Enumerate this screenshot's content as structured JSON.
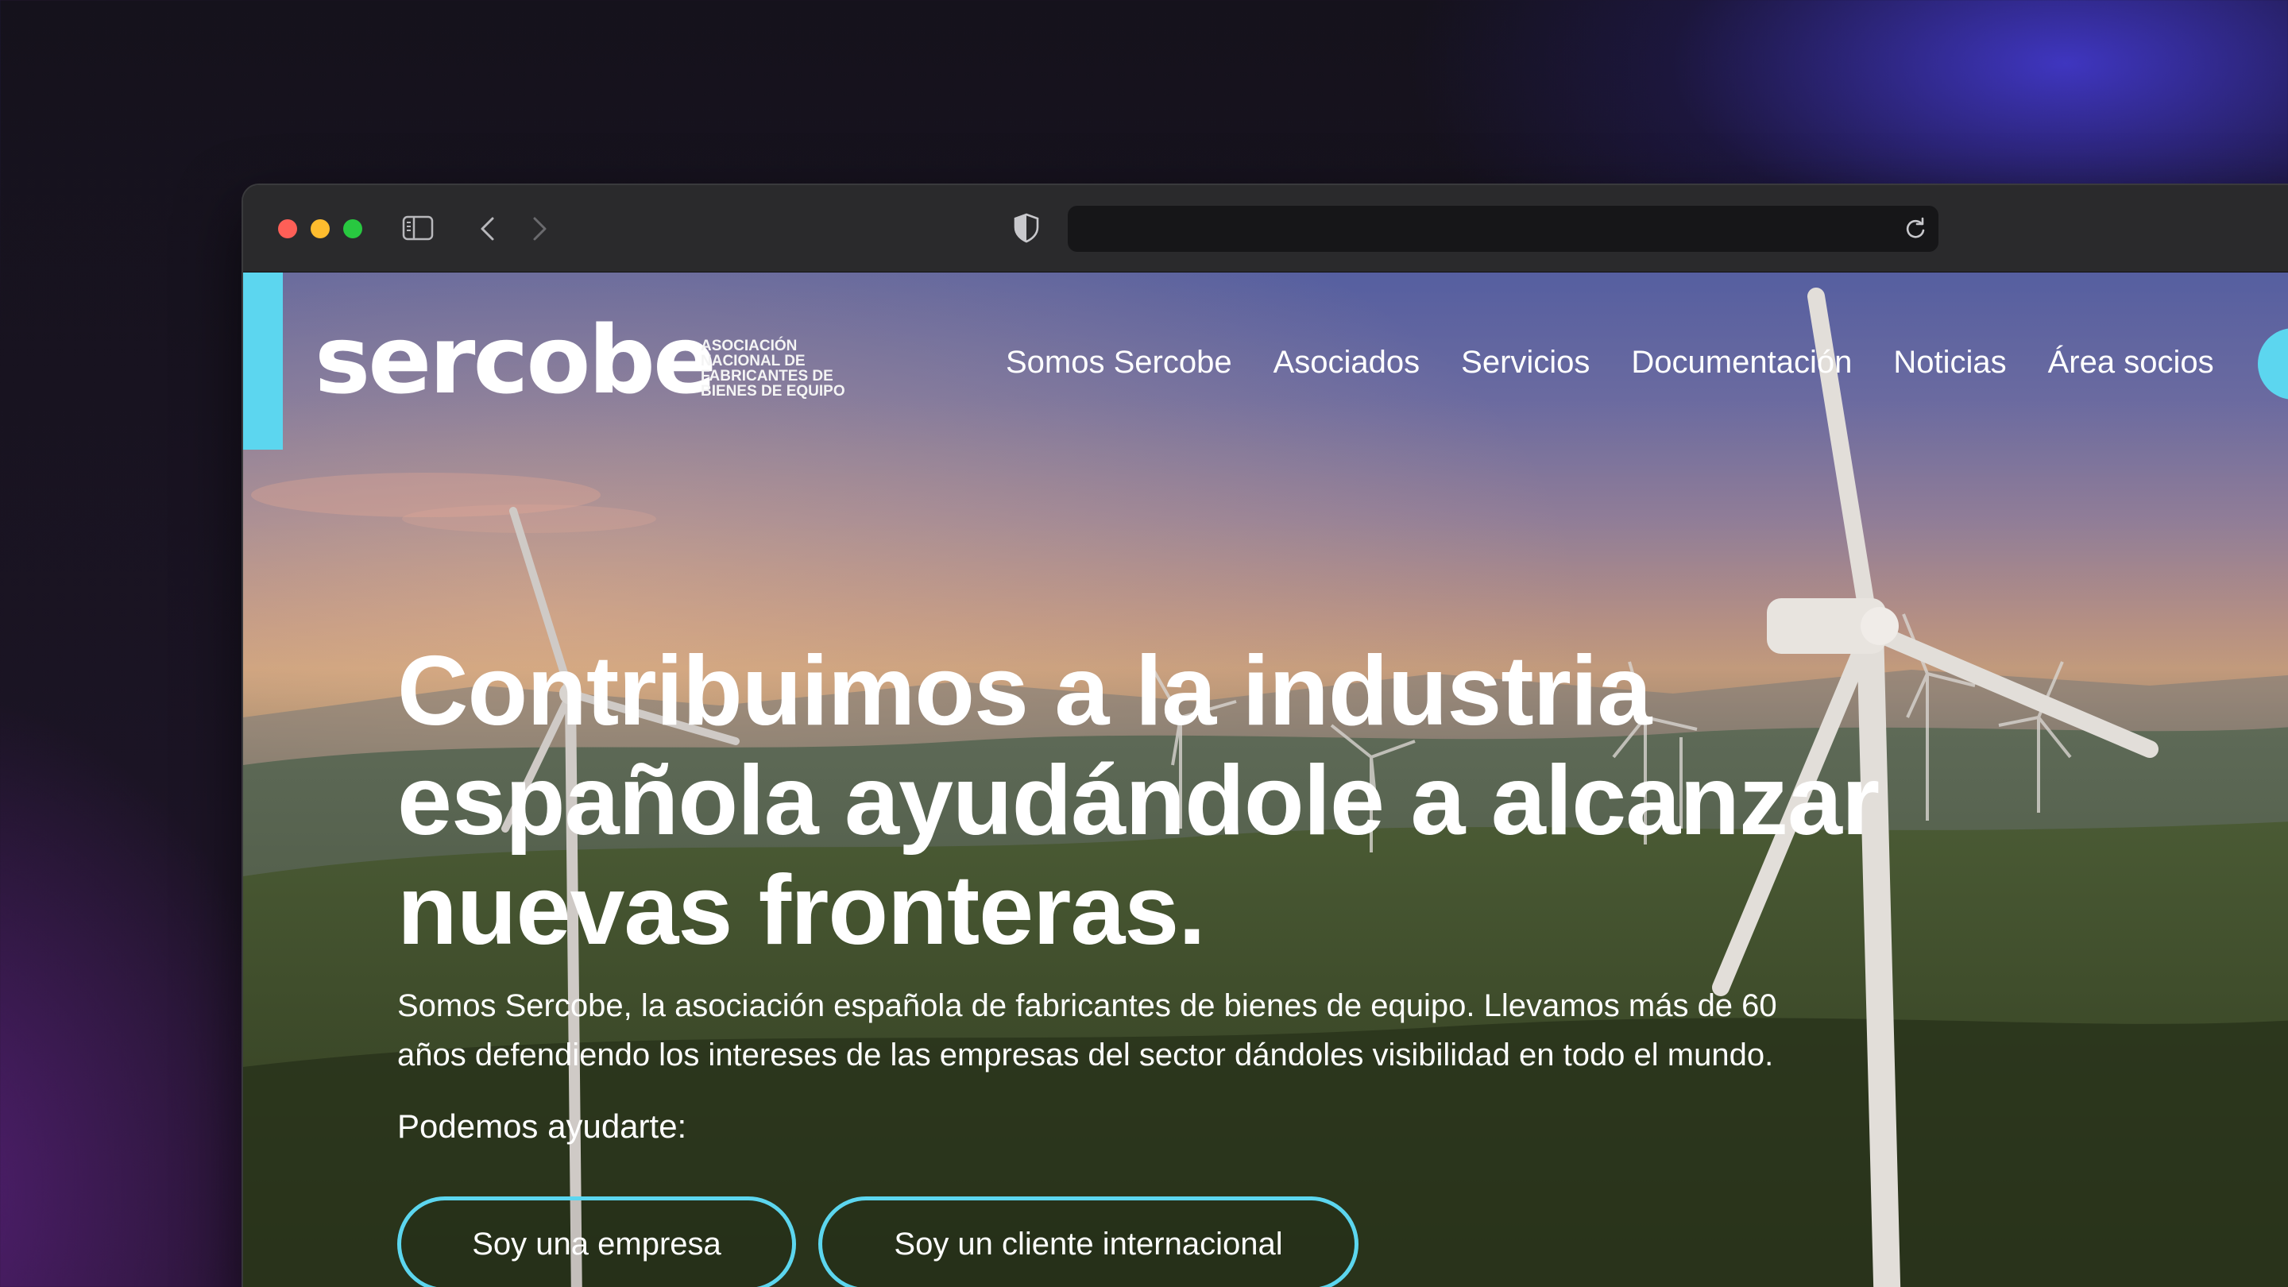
{
  "browser": {
    "address": "",
    "icons": {
      "sidebar": "sidebar-icon",
      "back": "chevron-left-icon",
      "forward": "chevron-right-icon",
      "privacy": "shield-icon",
      "reload": "reload-icon"
    }
  },
  "site": {
    "logo": {
      "wordmark": "sercobe",
      "tagline": [
        "ASOCIACIÓN",
        "NACIONAL DE",
        "FABRICANTES DE",
        "BIENES DE EQUIPO"
      ]
    },
    "nav": [
      {
        "label": "Somos Sercobe"
      },
      {
        "label": "Asociados"
      },
      {
        "label": "Servicios"
      },
      {
        "label": "Documentación"
      },
      {
        "label": "Noticias"
      },
      {
        "label": "Área socios"
      }
    ],
    "hero": {
      "title_lines": [
        "Contribuimos a la industria",
        "española ayudándole a alcanzar",
        "nuevas fronteras."
      ],
      "text_lines": [
        "Somos Sercobe, la asociación española de fabricantes de bienes de equipo. Llevamos más de 60",
        "años defendiendo los intereses de las empresas del sector dándoles visibilidad en todo el mundo."
      ],
      "help_label": "Podemos ayudarte:",
      "buttons": [
        {
          "label": "Soy una empresa"
        },
        {
          "label": "Soy un cliente internacional"
        }
      ]
    },
    "colors": {
      "accent": "#5cd6ef",
      "text": "#ffffff"
    }
  }
}
